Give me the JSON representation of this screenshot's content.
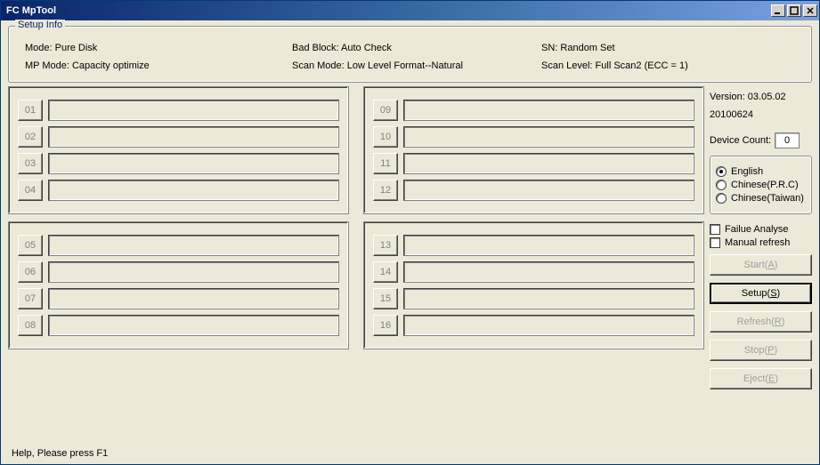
{
  "window": {
    "title": "FC MpTool"
  },
  "setup": {
    "legend": "Setup Info",
    "mode_label": "Mode: Pure Disk",
    "badblock": "Bad Block: Auto Check",
    "sn": "SN: Random Set",
    "mpmode": "MP Mode: Capacity optimize",
    "scanmode": "Scan Mode: Low Level Format--Natural",
    "scanlevel": "Scan Level: Full Scan2 (ECC = 1)"
  },
  "slots": {
    "s01": "01",
    "s02": "02",
    "s03": "03",
    "s04": "04",
    "s05": "05",
    "s06": "06",
    "s07": "07",
    "s08": "08",
    "s09": "09",
    "s10": "10",
    "s11": "11",
    "s12": "12",
    "s13": "13",
    "s14": "14",
    "s15": "15",
    "s16": "16"
  },
  "side": {
    "version": "Version: 03.05.02",
    "date": "20100624",
    "devcount_label": "Device Count:",
    "devcount_value": "0",
    "lang_en": "English",
    "lang_prc": "Chinese(P.R.C)",
    "lang_tw": "Chinese(Taiwan)",
    "failure": "Failue Analyse",
    "manual": "Manual refresh",
    "btn_start": "Start(",
    "btn_start_hot": "A",
    "btn_start_tail": ")",
    "btn_setup": "Setup(",
    "btn_setup_hot": "S",
    "btn_setup_tail": ")",
    "btn_refresh": "Refresh(",
    "btn_refresh_hot": "R",
    "btn_refresh_tail": ")",
    "btn_stop": "Stop(",
    "btn_stop_hot": "P",
    "btn_stop_tail": ")",
    "btn_eject": "Eject(",
    "btn_eject_hot": "E",
    "btn_eject_tail": ")"
  },
  "status": "Help, Please press F1"
}
